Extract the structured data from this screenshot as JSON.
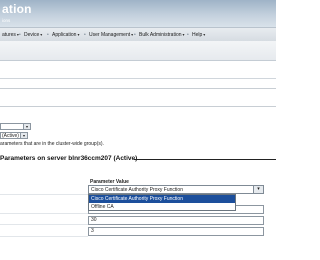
{
  "header": {
    "title": "ation",
    "subtitle": "ions"
  },
  "menu": {
    "items": [
      {
        "label": "atures",
        "arrow": "▾"
      },
      {
        "label": "Device",
        "arrow": "▾"
      },
      {
        "label": "Application",
        "arrow": "▾"
      },
      {
        "label": "User Management",
        "arrow": "▾"
      },
      {
        "label": "Bulk Administration",
        "arrow": "▾"
      },
      {
        "label": "Help",
        "arrow": "▾"
      }
    ],
    "separator": "•"
  },
  "status": {
    "select_value": "(Active)",
    "note": "arameters that are in the cluster-wide group(s)."
  },
  "section": {
    "title": "Parameters on server blnr36ccm207 (Active)"
  },
  "param": {
    "header": "Parameter Value",
    "selected": "Cisco Certificate Authority Proxy Function",
    "options": [
      "Cisco Certificate Authority Proxy Function",
      "Offline CA"
    ],
    "values": [
      "1",
      "30",
      "3"
    ]
  }
}
